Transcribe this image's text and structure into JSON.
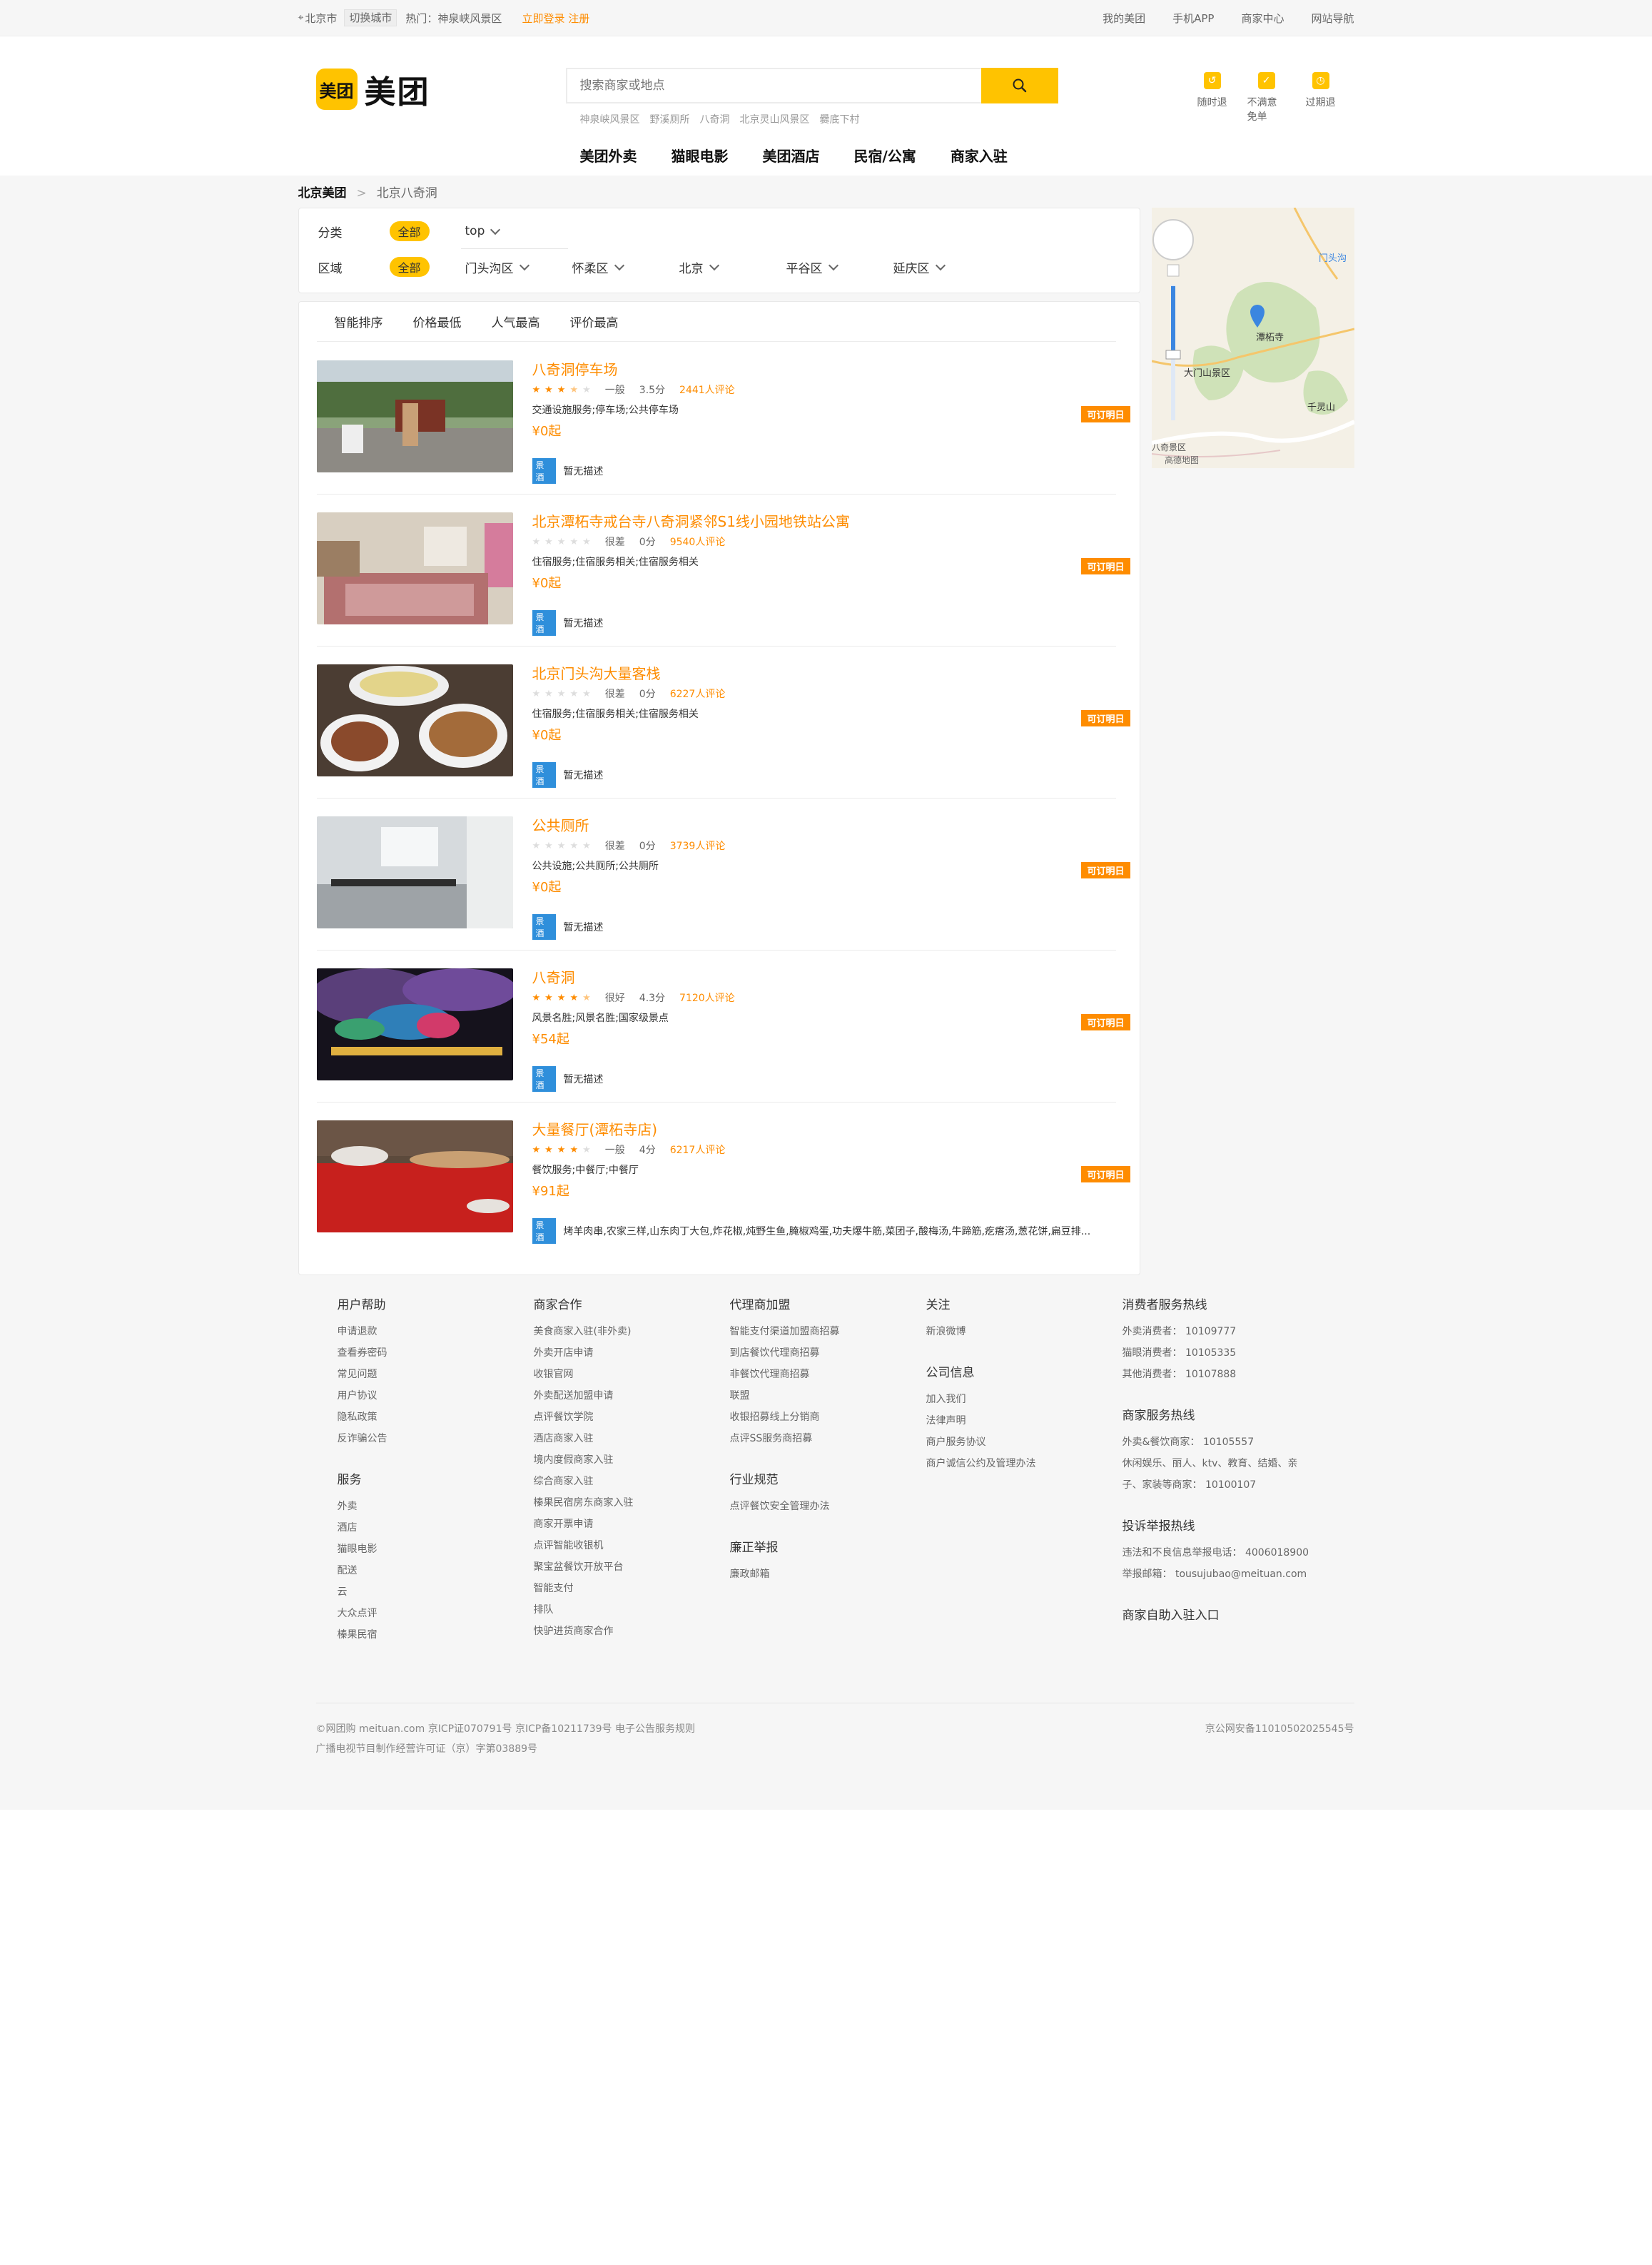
{
  "topbar": {
    "city": "北京市",
    "switch_city": "切换城市",
    "hot": "热门：神泉峡风景区",
    "login": "立即登录 注册",
    "links": [
      "我的美团",
      "手机APP",
      "商家中心",
      "网站导航"
    ]
  },
  "header": {
    "logo_badge": "美团",
    "logo_text": "美团",
    "search_placeholder": "搜索商家或地点",
    "hotwords": [
      "神泉峡风景区",
      "野溪厕所",
      "八奇洞",
      "北京灵山风景区",
      "爨底下村"
    ],
    "quick": [
      {
        "label": "随时退",
        "icon": "refund-icon"
      },
      {
        "label": "不满意免单",
        "icon": "satisfaction-icon"
      },
      {
        "label": "过期退",
        "icon": "expired-refund-icon"
      }
    ],
    "nav": [
      "美团外卖",
      "猫眼电影",
      "美团酒店",
      "民宿/公寓",
      "商家入驻"
    ]
  },
  "breadcrumb": {
    "home": "北京美团",
    "current": "北京八奇洞"
  },
  "filter": {
    "category_label": "分类",
    "category_all": "全部",
    "category_top": "top",
    "area_label": "区域",
    "area_all": "全部",
    "areas": [
      "门头沟区",
      "怀柔区",
      "北京",
      "平谷区",
      "延庆区"
    ]
  },
  "sort": [
    "智能排序",
    "价格最低",
    "人气最高",
    "评价最高"
  ],
  "items": [
    {
      "name": "八奇洞停车场",
      "stars": 3.5,
      "level": "一般",
      "score": "3.5分",
      "comments": "2441人评论",
      "category": "交通设施服务;停车场;公共停车场",
      "price": "¥0起",
      "book": "可订明日",
      "tag": "景酒",
      "desc": "暂无描述"
    },
    {
      "name": "北京潭柘寺戒台寺八奇洞紧邻S1线小园地铁站公寓",
      "stars": 0,
      "level": "很差",
      "score": "0分",
      "comments": "9540人评论",
      "category": "住宿服务;住宿服务相关;住宿服务相关",
      "price": "¥0起",
      "book": "可订明日",
      "tag": "景酒",
      "desc": "暂无描述"
    },
    {
      "name": "北京门头沟大量客栈",
      "stars": 0,
      "level": "很差",
      "score": "0分",
      "comments": "6227人评论",
      "category": "住宿服务;住宿服务相关;住宿服务相关",
      "price": "¥0起",
      "book": "可订明日",
      "tag": "景酒",
      "desc": "暂无描述"
    },
    {
      "name": "公共厕所",
      "stars": 0,
      "level": "很差",
      "score": "0分",
      "comments": "3739人评论",
      "category": "公共设施;公共厕所;公共厕所",
      "price": "¥0起",
      "book": "可订明日",
      "tag": "景酒",
      "desc": "暂无描述"
    },
    {
      "name": "八奇洞",
      "stars": 4.3,
      "level": "很好",
      "score": "4.3分",
      "comments": "7120人评论",
      "category": "风景名胜;风景名胜;国家级景点",
      "price": "¥54起",
      "book": "可订明日",
      "tag": "景酒",
      "desc": "暂无描述"
    },
    {
      "name": "大量餐厅(潭柘寺店)",
      "stars": 4,
      "level": "一般",
      "score": "4分",
      "comments": "6217人评论",
      "category": "餐饮服务;中餐厅;中餐厅",
      "price": "¥91起",
      "book": "可订明日",
      "tag": "景酒",
      "desc": "烤羊肉串,农家三样,山东肉丁大包,炸花椒,炖野生鱼,腌椒鸡蛋,功夫爆牛筋,菜团子,酸梅汤,牛蹄筋,疙瘩汤,葱花饼,扁豆排..."
    }
  ],
  "map_labels": {
    "temple": "潭柘寺",
    "dasanshan": "大门山景区",
    "qianlingshan": "千灵山",
    "mentougou": "门头沟",
    "scenic": "八奇景区",
    "credit": "高德地图"
  },
  "footer": {
    "help": {
      "title": "用户帮助",
      "links": [
        "申请退款",
        "查看券密码",
        "常见问题",
        "用户协议",
        "隐私政策",
        "反诈骗公告"
      ]
    },
    "services": {
      "title": "服务",
      "links": [
        "外卖",
        "酒店",
        "猫眼电影",
        "配送",
        "云",
        "大众点评",
        "榛果民宿"
      ]
    },
    "merchant": {
      "title": "商家合作",
      "links": [
        "美食商家入驻(非外卖)",
        "外卖开店申请",
        "收银官网",
        "外卖配送加盟申请",
        "点评餐饮学院",
        "酒店商家入驻",
        "境内度假商家入驻",
        "综合商家入驻",
        "榛果民宿房东商家入驻",
        "商家开票申请",
        "点评智能收银机",
        "聚宝盆餐饮开放平台",
        "智能支付",
        "排队",
        "快驴进货商家合作"
      ]
    },
    "agent": {
      "title": "代理商加盟",
      "links": [
        "智能支付渠道加盟商招募",
        "到店餐饮代理商招募",
        "非餐饮代理商招募",
        "联盟",
        "收银招募线上分销商",
        "点评SS服务商招募"
      ]
    },
    "industry": {
      "title": "行业规范",
      "links": [
        "点评餐饮安全管理办法"
      ]
    },
    "integrity": {
      "title": "廉正举报",
      "links": [
        "廉政邮箱"
      ]
    },
    "follow": {
      "title": "关注",
      "links": [
        "新浪微博"
      ]
    },
    "company": {
      "title": "公司信息",
      "links": [
        "加入我们",
        "法律声明",
        "商户服务协议",
        "商户诚信公约及管理办法"
      ]
    },
    "consumer_hotline": {
      "title": "消费者服务热线",
      "lines": [
        "外卖消费者：  10109777",
        "猫眼消费者：  10105335",
        "其他消费者：  10107888"
      ]
    },
    "merchant_hotline": {
      "title": "商家服务热线",
      "lines": [
        "外卖&餐饮商家：  10105557",
        "休闲娱乐、丽人、ktv、教育、结婚、亲",
        "子、家装等商家：  10100107"
      ]
    },
    "report_hotline": {
      "title": "投诉举报热线",
      "lines": [
        "违法和不良信息举报电话：  4006018900",
        "举报邮箱：  tousujubao@meituan.com"
      ]
    },
    "self_join": "商家自助入驻入口",
    "copyright1": "©网团购 meituan.com 京ICP证070791号 京ICP备10211739号 电子公告服务规则",
    "copyright2": "广播电视节目制作经营许可证（京）字第03889号",
    "police": "京公网安备11010502025545号"
  }
}
